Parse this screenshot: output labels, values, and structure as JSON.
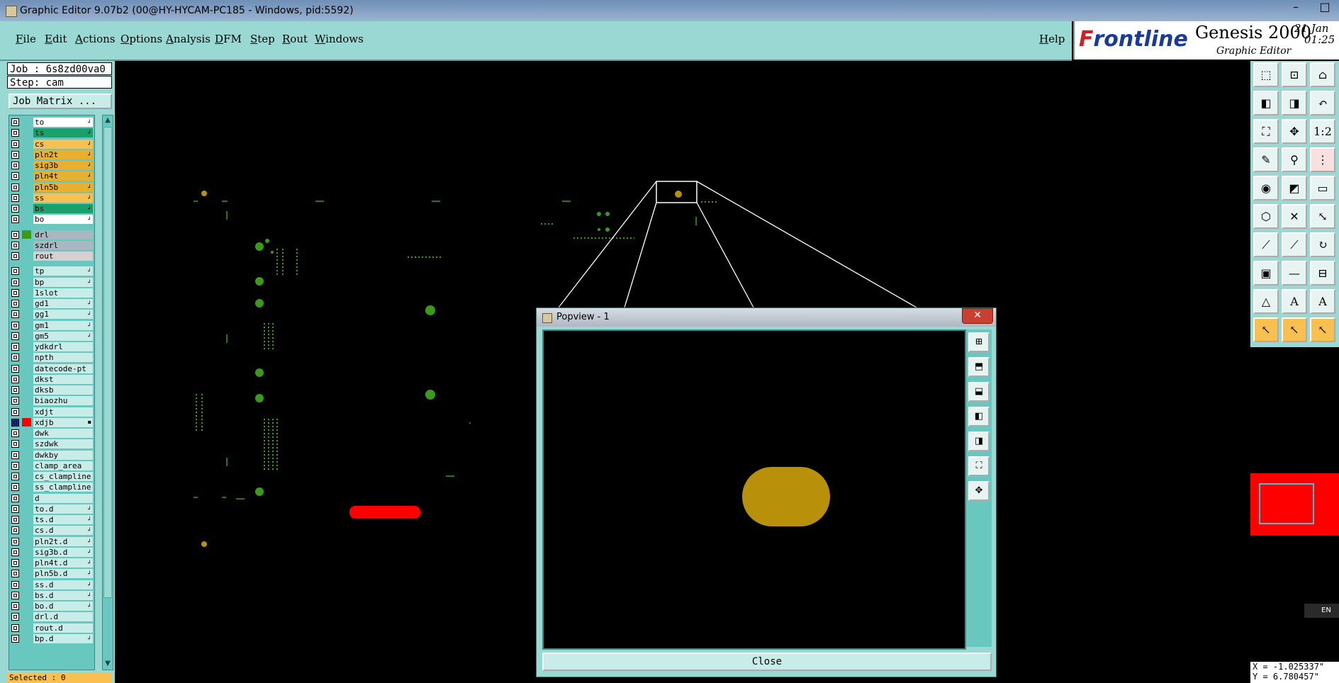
{
  "window": {
    "title": "Graphic Editor 9.07b2 (00@HY-HYCAM-PC185 - Windows, pid:5592)",
    "controls": [
      "–",
      "□",
      "✕"
    ]
  },
  "menu": {
    "items": [
      "File",
      "Edit",
      "Actions",
      "Options",
      "Analysis",
      "DFM",
      "Step",
      "Rout",
      "Windows"
    ],
    "help": "Help"
  },
  "brand": {
    "logo_part1": "F",
    "logo_part2": "rontline",
    "product": "Genesis 2000",
    "subtitle": "Graphic Editor",
    "date": "21 Jan",
    "time": "01:25"
  },
  "job": {
    "job_line": "Job : 6s8zd00va0",
    "step_line": "Step: cam",
    "matrix_button": "Job Matrix ..."
  },
  "colors": {
    "panel": "#9ad8d4",
    "layer_bg": "#68c8c0",
    "pad_color": "#b8900a",
    "trace_green": "#3a9a1a",
    "highlight_red": "#ff0000"
  },
  "layers": [
    {
      "name": "to",
      "bg": "#ffffff",
      "swatch": "",
      "pol": "↲"
    },
    {
      "name": "ts",
      "bg": "#1aa06a",
      "swatch": "",
      "pol": "↲"
    },
    {
      "name": "cs",
      "bg": "#f8c050",
      "swatch": "",
      "pol": "↲"
    },
    {
      "name": "pln2t",
      "bg": "#e8b030",
      "swatch": "",
      "pol": "↲"
    },
    {
      "name": "sig3b",
      "bg": "#e8b030",
      "swatch": "",
      "pol": "↲"
    },
    {
      "name": "pln4t",
      "bg": "#e8b030",
      "swatch": "",
      "pol": "↲"
    },
    {
      "name": "pln5b",
      "bg": "#e8b030",
      "swatch": "",
      "pol": "↲"
    },
    {
      "name": "ss",
      "bg": "#f8c050",
      "swatch": "",
      "pol": "↲"
    },
    {
      "name": "bs",
      "bg": "#1aa06a",
      "swatch": "",
      "pol": "↲"
    },
    {
      "name": "bo",
      "bg": "#ffffff",
      "swatch": "",
      "pol": "↲"
    },
    {
      "name": "drl",
      "bg": "#a8b8c0",
      "swatch": "#3a9a1a",
      "pol": ""
    },
    {
      "name": "szdrl",
      "bg": "#a8b8c0",
      "swatch": "",
      "pol": ""
    },
    {
      "name": "rout",
      "bg": "#d8d0d0",
      "swatch": "",
      "pol": ""
    },
    {
      "name": "tp",
      "bg": "#c8ece8",
      "swatch": "",
      "pol": "↲"
    },
    {
      "name": "bp",
      "bg": "#c8ece8",
      "swatch": "",
      "pol": "↲"
    },
    {
      "name": "1slot",
      "bg": "#c8ece8",
      "swatch": "",
      "pol": ""
    },
    {
      "name": "gd1",
      "bg": "#c8ece8",
      "swatch": "",
      "pol": "↲"
    },
    {
      "name": "gg1",
      "bg": "#c8ece8",
      "swatch": "",
      "pol": "↲"
    },
    {
      "name": "gm1",
      "bg": "#c8ece8",
      "swatch": "",
      "pol": "↲"
    },
    {
      "name": "gm5",
      "bg": "#c8ece8",
      "swatch": "",
      "pol": "↲"
    },
    {
      "name": "ydkdrl",
      "bg": "#c8ece8",
      "swatch": "",
      "pol": ""
    },
    {
      "name": "npth",
      "bg": "#c8ece8",
      "swatch": "",
      "pol": ""
    },
    {
      "name": "datecode-pt",
      "bg": "#c8ece8",
      "swatch": "",
      "pol": ""
    },
    {
      "name": "dkst",
      "bg": "#c8ece8",
      "swatch": "",
      "pol": ""
    },
    {
      "name": "dksb",
      "bg": "#c8ece8",
      "swatch": "",
      "pol": ""
    },
    {
      "name": "biaozhu",
      "bg": "#c8ece8",
      "swatch": "",
      "pol": ""
    },
    {
      "name": "xdjt",
      "bg": "#c8ece8",
      "swatch": "",
      "pol": ""
    },
    {
      "name": "xdjb",
      "bg": "#c8ece8",
      "swatch": "#ff0000",
      "pol": "▪",
      "active": true
    },
    {
      "name": "dwk",
      "bg": "#c8ece8",
      "swatch": "",
      "pol": ""
    },
    {
      "name": "szdwk",
      "bg": "#c8ece8",
      "swatch": "",
      "pol": ""
    },
    {
      "name": "dwkby",
      "bg": "#c8ece8",
      "swatch": "",
      "pol": ""
    },
    {
      "name": "clamp_area",
      "bg": "#c8ece8",
      "swatch": "",
      "pol": ""
    },
    {
      "name": "cs_clampline",
      "bg": "#c8ece8",
      "swatch": "",
      "pol": ""
    },
    {
      "name": "ss_clampline",
      "bg": "#c8ece8",
      "swatch": "",
      "pol": ""
    },
    {
      "name": "d",
      "bg": "#c8ece8",
      "swatch": "",
      "pol": ""
    },
    {
      "name": "to.d",
      "bg": "#c8ece8",
      "swatch": "",
      "pol": "↲"
    },
    {
      "name": "ts.d",
      "bg": "#c8ece8",
      "swatch": "",
      "pol": "↲"
    },
    {
      "name": "cs.d",
      "bg": "#c8ece8",
      "swatch": "",
      "pol": "↲"
    },
    {
      "name": "pln2t.d",
      "bg": "#c8ece8",
      "swatch": "",
      "pol": "↲"
    },
    {
      "name": "sig3b.d",
      "bg": "#c8ece8",
      "swatch": "",
      "pol": "↲"
    },
    {
      "name": "pln4t.d",
      "bg": "#c8ece8",
      "swatch": "",
      "pol": "↲"
    },
    {
      "name": "pln5b.d",
      "bg": "#c8ece8",
      "swatch": "",
      "pol": "↲"
    },
    {
      "name": "ss.d",
      "bg": "#c8ece8",
      "swatch": "",
      "pol": "↲"
    },
    {
      "name": "bs.d",
      "bg": "#c8ece8",
      "swatch": "",
      "pol": "↲"
    },
    {
      "name": "bo.d",
      "bg": "#c8ece8",
      "swatch": "",
      "pol": "↲"
    },
    {
      "name": "drl.d",
      "bg": "#c8ece8",
      "swatch": "",
      "pol": ""
    },
    {
      "name": "rout.d",
      "bg": "#c8ece8",
      "swatch": "",
      "pol": ""
    },
    {
      "name": "bp.d",
      "bg": "#c8ece8",
      "swatch": "",
      "pol": "↲"
    }
  ],
  "status": {
    "selected": "Selected : 0",
    "x": "X = -1.025337\"",
    "y": "Y = 6.780457\"",
    "lang": "EN"
  },
  "popview": {
    "title": "Popview - 1",
    "close_label": "Close",
    "close_x": "✕"
  },
  "tools": [
    {
      "icon": "zoom-home-icon",
      "glyph": "⬚",
      "style": ""
    },
    {
      "icon": "zoom-in-icon",
      "glyph": "⊡",
      "style": ""
    },
    {
      "icon": "home-icon",
      "glyph": "⌂",
      "style": ""
    },
    {
      "icon": "pan-left-icon",
      "glyph": "◧",
      "style": ""
    },
    {
      "icon": "pan-right-icon",
      "glyph": "◨",
      "style": ""
    },
    {
      "icon": "undo-zoom-icon",
      "glyph": "↶",
      "style": ""
    },
    {
      "icon": "fit-screen-icon",
      "glyph": "⛶",
      "style": ""
    },
    {
      "icon": "center-icon",
      "glyph": "✥",
      "style": ""
    },
    {
      "icon": "scale-icon",
      "glyph": "1:2",
      "style": ""
    },
    {
      "icon": "wrench-icon",
      "glyph": "✎",
      "style": ""
    },
    {
      "icon": "pin-icon",
      "glyph": "⚲",
      "style": ""
    },
    {
      "icon": "net-icon",
      "glyph": "⋮",
      "style": "red"
    },
    {
      "icon": "add-pad-icon",
      "glyph": "◉",
      "style": ""
    },
    {
      "icon": "add-line-icon",
      "glyph": "◩",
      "style": ""
    },
    {
      "icon": "measure-icon",
      "glyph": "▭",
      "style": ""
    },
    {
      "icon": "connect-icon",
      "glyph": "⬡",
      "style": ""
    },
    {
      "icon": "cross-icon",
      "glyph": "✕",
      "style": ""
    },
    {
      "icon": "snap-icon",
      "glyph": "⤡",
      "style": ""
    },
    {
      "icon": "draw-line-icon",
      "glyph": "⟋",
      "style": ""
    },
    {
      "icon": "draw-line2-icon",
      "glyph": "⟋",
      "style": ""
    },
    {
      "icon": "arc-icon",
      "glyph": "↻",
      "style": ""
    },
    {
      "icon": "grid-icon",
      "glyph": "▣",
      "style": ""
    },
    {
      "icon": "dash-icon",
      "glyph": "—",
      "style": ""
    },
    {
      "icon": "dimension-icon",
      "glyph": "⊟",
      "style": ""
    },
    {
      "icon": "triangle-icon",
      "glyph": "△",
      "style": ""
    },
    {
      "icon": "arrow-a-icon",
      "glyph": "A",
      "style": ""
    },
    {
      "icon": "arrow-a2-icon",
      "glyph": "A",
      "style": ""
    },
    {
      "icon": "select-arrow-icon",
      "glyph": "↖",
      "style": "yel"
    },
    {
      "icon": "select-arrow2-icon",
      "glyph": "↖",
      "style": "yel"
    },
    {
      "icon": "select-arrow3-icon",
      "glyph": "↖",
      "style": "yel"
    }
  ],
  "popview_tools": [
    {
      "icon": "popview-zoom-icon",
      "glyph": "⊞"
    },
    {
      "icon": "popview-up-icon",
      "glyph": "⬒"
    },
    {
      "icon": "popview-down-icon",
      "glyph": "⬓"
    },
    {
      "icon": "popview-left-icon",
      "glyph": "◧"
    },
    {
      "icon": "popview-right-icon",
      "glyph": "◨"
    },
    {
      "icon": "popview-fit-icon",
      "glyph": "⛶"
    },
    {
      "icon": "popview-center-icon",
      "glyph": "✥"
    }
  ]
}
